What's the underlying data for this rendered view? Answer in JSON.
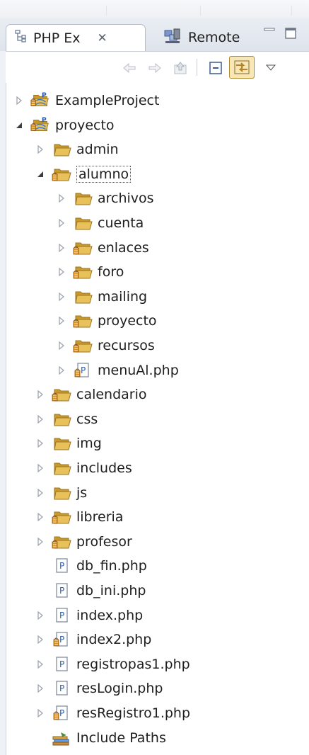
{
  "view_tabs": [
    {
      "label": "PHP Ex",
      "active": true
    },
    {
      "label": "Remote",
      "active": false
    }
  ],
  "icons": {
    "toolbar": [
      "back-icon",
      "forward-icon",
      "up-icon",
      "collapse-all-icon",
      "link-with-editor-icon",
      "view-menu-icon"
    ],
    "view": [
      "minimize-icon",
      "maximize-icon"
    ]
  },
  "tree": {
    "nodes": [
      {
        "label": "ExampleProject",
        "kind": "project",
        "depth": 0,
        "expander": "collapsed"
      },
      {
        "label": "proyecto",
        "kind": "project",
        "depth": 0,
        "expander": "expanded"
      },
      {
        "label": "admin",
        "kind": "folder",
        "depth": 1,
        "expander": "collapsed"
      },
      {
        "label": "alumno",
        "kind": "folder-dec",
        "depth": 1,
        "expander": "expanded",
        "selected": true
      },
      {
        "label": "archivos",
        "kind": "folder",
        "depth": 2,
        "expander": "collapsed"
      },
      {
        "label": "cuenta",
        "kind": "folder",
        "depth": 2,
        "expander": "collapsed"
      },
      {
        "label": "enlaces",
        "kind": "folder-dec",
        "depth": 2,
        "expander": "collapsed"
      },
      {
        "label": "foro",
        "kind": "folder-dec",
        "depth": 2,
        "expander": "collapsed"
      },
      {
        "label": "mailing",
        "kind": "folder",
        "depth": 2,
        "expander": "collapsed"
      },
      {
        "label": "proyecto",
        "kind": "folder-dec",
        "depth": 2,
        "expander": "collapsed"
      },
      {
        "label": "recursos",
        "kind": "folder-dec",
        "depth": 2,
        "expander": "collapsed"
      },
      {
        "label": "menuAl.php",
        "kind": "php-dec",
        "depth": 2,
        "expander": "collapsed"
      },
      {
        "label": "calendario",
        "kind": "folder-dec",
        "depth": 1,
        "expander": "collapsed"
      },
      {
        "label": "css",
        "kind": "folder",
        "depth": 1,
        "expander": "collapsed"
      },
      {
        "label": "img",
        "kind": "folder",
        "depth": 1,
        "expander": "collapsed"
      },
      {
        "label": "includes",
        "kind": "folder",
        "depth": 1,
        "expander": "collapsed"
      },
      {
        "label": "js",
        "kind": "folder",
        "depth": 1,
        "expander": "collapsed"
      },
      {
        "label": "libreria",
        "kind": "folder-dec",
        "depth": 1,
        "expander": "collapsed"
      },
      {
        "label": "profesor",
        "kind": "folder-dec",
        "depth": 1,
        "expander": "collapsed"
      },
      {
        "label": "db_fin.php",
        "kind": "php",
        "depth": 1,
        "expander": "none"
      },
      {
        "label": "db_ini.php",
        "kind": "php",
        "depth": 1,
        "expander": "none"
      },
      {
        "label": "index.php",
        "kind": "php",
        "depth": 1,
        "expander": "collapsed"
      },
      {
        "label": "index2.php",
        "kind": "php-dec",
        "depth": 1,
        "expander": "collapsed"
      },
      {
        "label": "registropas1.php",
        "kind": "php",
        "depth": 1,
        "expander": "collapsed"
      },
      {
        "label": "resLogin.php",
        "kind": "php",
        "depth": 1,
        "expander": "collapsed"
      },
      {
        "label": "resRegistro1.php",
        "kind": "php-dec",
        "depth": 1,
        "expander": "collapsed"
      },
      {
        "label": "Include Paths",
        "kind": "include-paths",
        "depth": 1,
        "expander": "none"
      }
    ]
  },
  "colors": {
    "folder": "#e8c15a",
    "folder_dark": "#c89a2a",
    "php_blue": "#2a5db0",
    "decorator": "#d88a1c"
  }
}
